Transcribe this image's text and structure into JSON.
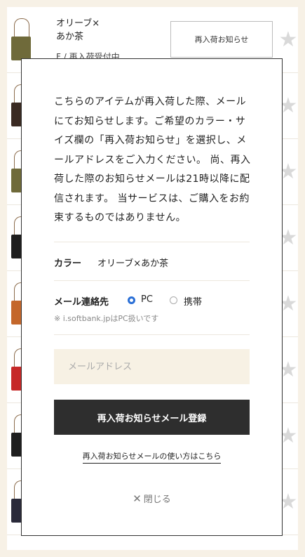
{
  "list": {
    "first_item": {
      "name": "オリーブ×\nあか茶",
      "stock": "F / 再入荷受付中",
      "button": "再入荷お知らせ"
    },
    "thumb_colors": [
      "#6f6a3a",
      "#3a2a22",
      "#6f6a3a",
      "#1e1e1e",
      "#c4672b",
      "#c62828",
      "#1e1e1e",
      "#2a2a3a"
    ]
  },
  "modal": {
    "intro": "こちらのアイテムが再入荷した際、メールにてお知らせします。ご希望のカラー・サイズ欄の「再入荷お知らせ」を選択し、メールアドレスをご入力ください。 尚、再入荷した際のお知らせメールは21時以降に配信されます。 当サービスは、ご購入をお約束するものではありません。",
    "color_label": "カラー",
    "color_value": "オリーブ×あか茶",
    "mail_label": "メール連絡先",
    "option_pc": "PC",
    "option_mobile": "携帯",
    "selected": "PC",
    "note": "※ i.softbank.jpはPC扱いです",
    "email_placeholder": "メールアドレス",
    "submit": "再入荷お知らせメール登録",
    "howto": "再入荷お知らせメールの使い方はこちら",
    "close": "閉じる"
  },
  "colors": {
    "page_bg": "#f7f1e6",
    "input_bg": "#f7f1e4",
    "button_bg": "#2e2e2e",
    "radio_active": "#2a6fd6"
  }
}
